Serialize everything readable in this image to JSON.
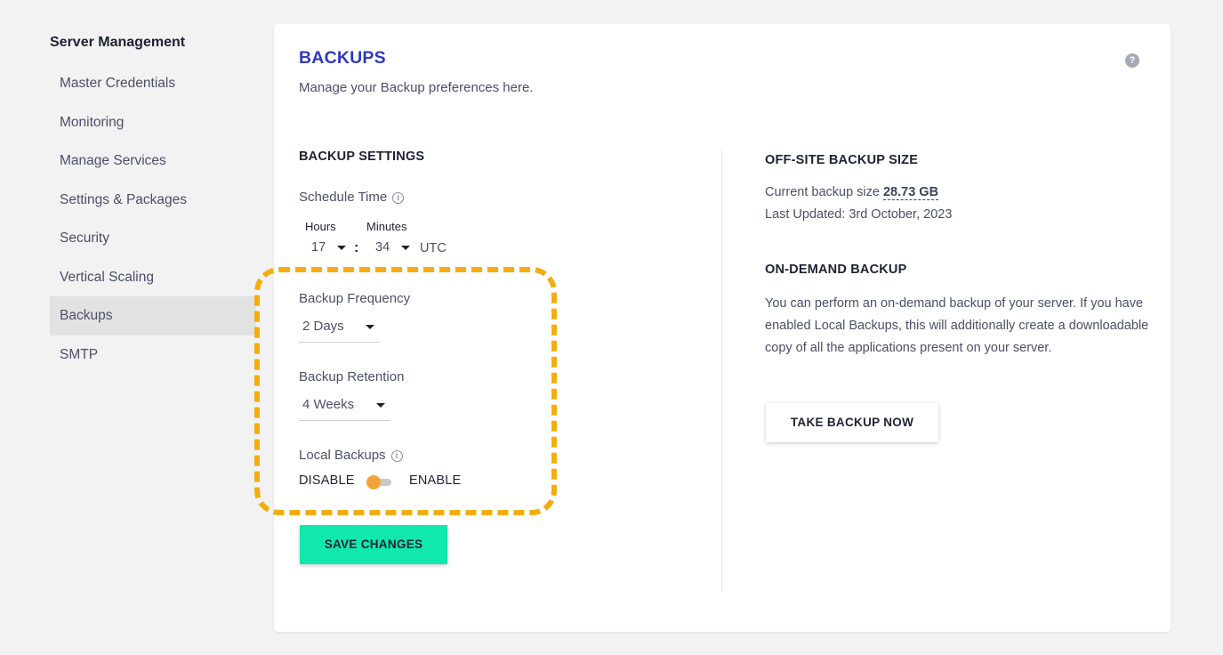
{
  "sidebar": {
    "title": "Server Management",
    "items": [
      {
        "label": "Master Credentials"
      },
      {
        "label": "Monitoring"
      },
      {
        "label": "Manage Services"
      },
      {
        "label": "Settings & Packages"
      },
      {
        "label": "Security"
      },
      {
        "label": "Vertical Scaling"
      },
      {
        "label": "Backups",
        "active": true
      },
      {
        "label": "SMTP"
      }
    ]
  },
  "header": {
    "title": "BACKUPS",
    "subtitle": "Manage your Backup preferences here.",
    "help_icon": "?"
  },
  "backup_settings": {
    "heading": "BACKUP SETTINGS",
    "schedule_label": "Schedule Time",
    "info_icon": "i",
    "hours_label": "Hours",
    "minutes_label": "Minutes",
    "hours_value": "17",
    "minutes_value": "34",
    "separator": ":",
    "timezone": "UTC",
    "frequency_label": "Backup Frequency",
    "frequency_value": "2 Days",
    "retention_label": "Backup Retention",
    "retention_value": "4 Weeks",
    "local_label": "Local Backups",
    "disable_label": "DISABLE",
    "enable_label": "ENABLE",
    "local_enabled": false,
    "save_label": "SAVE CHANGES"
  },
  "offsite": {
    "heading": "OFF-SITE BACKUP SIZE",
    "size_prefix": "Current backup size",
    "size_value": "28.73 GB",
    "last_updated": "Last Updated: 3rd October, 2023"
  },
  "ondemand": {
    "heading": "ON-DEMAND BACKUP",
    "description": "You can perform an on-demand backup of your server. If you have enabled Local Backups, this will additionally create a downloadable copy of all the applications present on your server.",
    "button_label": "TAKE BACKUP NOW"
  },
  "colors": {
    "accent_title": "#2f39bf",
    "save_button": "#10e8ad",
    "highlight": "#f4ad0f",
    "toggle_knob": "#f0a23a"
  }
}
